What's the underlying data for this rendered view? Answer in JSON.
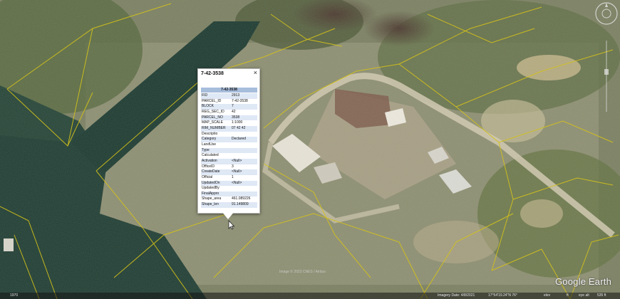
{
  "popup": {
    "title": "7-42-3538",
    "header": "7-42-3538",
    "close": "×",
    "rows": [
      {
        "k": "FID",
        "v": "2913"
      },
      {
        "k": "PARCEL_ID",
        "v": "7-42-3538"
      },
      {
        "k": "BLOCK",
        "v": "7"
      },
      {
        "k": "REG_SEC_ID",
        "v": "42"
      },
      {
        "k": "PARCEL_NO",
        "v": "3538"
      },
      {
        "k": "MAP_SCALE",
        "v": "1:1000"
      },
      {
        "k": "RIM_NUMBER",
        "v": "07 42 42"
      },
      {
        "k": "Descriptio",
        "v": ""
      },
      {
        "k": "Category",
        "v": "Declared"
      },
      {
        "k": "LandUse",
        "v": ""
      },
      {
        "k": "Type",
        "v": ""
      },
      {
        "k": "Calculated",
        "v": ""
      },
      {
        "k": "Activation",
        "v": "<Null>"
      },
      {
        "k": "OfficeID",
        "v": "3"
      },
      {
        "k": "CreateDate",
        "v": "<Null>"
      },
      {
        "k": "Official",
        "v": "1"
      },
      {
        "k": "UpdatedOn",
        "v": "<Null>"
      },
      {
        "k": "UpdatedBy",
        "v": ""
      },
      {
        "k": "FinalAppro",
        "v": ""
      },
      {
        "k": "Shape_area",
        "v": "461.089226"
      },
      {
        "k": "Shape_len",
        "v": "91.149809"
      }
    ]
  },
  "status": {
    "scale": "1970",
    "imagery": "Imagery Date: 4/8/2021",
    "coords": "17°54'19.24\"N  76°",
    "elev": "elev",
    "eye": "eye alt",
    "alt": "535 ft",
    "ft": "ft"
  },
  "copyright": "Image © 2023 CNES / Airbus",
  "logo": "Google Earth",
  "colors": {
    "parcel_line": "#d4c21a",
    "water": "#1c3a30",
    "vegetation": "#6f7e55"
  }
}
